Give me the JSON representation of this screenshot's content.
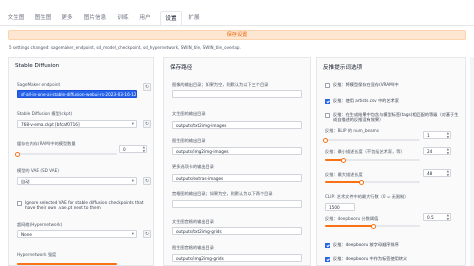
{
  "tabs": [
    "文生图",
    "图生图",
    "更多",
    "图片信息",
    "训练",
    "用户",
    "设置",
    "扩展"
  ],
  "active_tab": 6,
  "save_button": "保存设置",
  "changed_text": "5 settings changed: sagemaker_endpoint, sd_model_checkpoint, sd_hypernetwork, SWIN_tile, SWIN_tile_overlap.",
  "left": {
    "title": "Stable Diffusion",
    "endpoint_label": "SageMaker endpoint",
    "endpoint_value": "sf-all-in-one-ai-stable-diffusion-webui-rs-2023-03-16-12-50-12-888",
    "checkpoint_label": "Stable Diffusion 模型(ckpt)",
    "checkpoint_value": "768-v-ema.ckpt [bfcaf0716]",
    "cache_label": "缓存在内存(RAM)中的模型数量",
    "cache_value": "0",
    "vae_label": "模型的 VAE (SD VAE)",
    "vae_value": "自动",
    "ignore_vae_label": "Ignore selected VAE for stable diffusion checkpoints that have their own .vae.pt next to them",
    "hypernetwork_label": "超网络(Hypernetwork)",
    "hypernetwork_value": "None",
    "hypernet_strength_label": "Hypernetwork 强度"
  },
  "mid": {
    "title": "保存路径",
    "fields": [
      {
        "label": "图像的输出目录；如果为空，则默认为以下三个目录",
        "value": ""
      },
      {
        "label": "文生图的输出目录",
        "value": "outputs/txt2img-images"
      },
      {
        "label": "图生图的输出目录",
        "value": "outputs/img2img-images"
      },
      {
        "label": "更多选项卡的输出目录",
        "value": "outputs/extras-images"
      },
      {
        "label": "宫格图的输出目录；如果为空，则默认为以下两个目录",
        "value": ""
      },
      {
        "label": "文生图宫格的输出目录",
        "value": "outputs/txt2img-grids"
      },
      {
        "label": "图生图宫格的输出目录",
        "value": "outputs/img2img-grids"
      }
    ]
  },
  "right": {
    "title": "反推提示词选项",
    "opt1": "反推：将模型保存在显存(VRAM)中",
    "opt2": "反推：使用 artists.csv 中的艺术家",
    "opt3": "反推：在生成结果中包含与模型标签(tags)相匹配的等级（对基于生成自描述的反推没有效果）",
    "beams_label": "反推：BLIP 的 num_beams",
    "beams_value": "1",
    "minlen_label": "反推：最小描述长度（不包括艺术家，等）",
    "minlen_value": "24",
    "maxlen_label": "反推：最大描述长度",
    "maxlen_value": "48",
    "clip_label": "CLIP: 艺术文件中的最大行数（0 = 无限制）",
    "clip_value": "1500",
    "thresh_label": "反推：deepbooru 分数阈值",
    "thresh_value": "0.5",
    "opt4": "反推：deepbooru 按字母顺序排序",
    "opt5": "反推：deepbooru 中作为标签使用转义"
  }
}
